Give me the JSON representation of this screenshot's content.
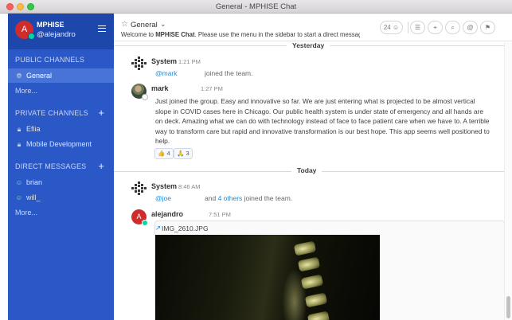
{
  "window": {
    "title": "General - MPHISE Chat"
  },
  "sidebar": {
    "team_name": "MPHISE",
    "username": "@alejandro",
    "avatar_letter": "A",
    "public_channels": {
      "title": "PUBLIC CHANNELS",
      "items": [
        {
          "label": "General",
          "icon": "globe-icon",
          "active": true
        }
      ],
      "more": "More..."
    },
    "private_channels": {
      "title": "PRIVATE CHANNELS",
      "items": [
        {
          "label": "Efiia",
          "icon": "lock-icon"
        },
        {
          "label": "Mobile Development",
          "icon": "lock-icon"
        }
      ]
    },
    "direct_messages": {
      "title": "DIRECT MESSAGES",
      "items": [
        {
          "label": "brian",
          "icon": "user-icon"
        },
        {
          "label": "will_",
          "icon": "user-icon"
        }
      ],
      "more": "More..."
    },
    "colors": {
      "background": "#2a58c6",
      "header": "#1d47ab",
      "active": "#4774d6"
    }
  },
  "header": {
    "channel_name": "General",
    "purpose": "Welcome to MPHISE Chat. Please use the menu in the sidebar to start a direct message ...",
    "purpose_bold": "MPHISE Chat",
    "member_count": "24",
    "icons": [
      "members-icon",
      "channel-files-icon",
      "pin-icon",
      "search-icon",
      "mentions-icon",
      "flag-icon"
    ]
  },
  "messages": {
    "divider_yesterday": "Yesterday",
    "divider_today": "Today",
    "posts": [
      {
        "author": "System",
        "time": "1:21 PM",
        "mention": "@mark",
        "text": "joined the team."
      },
      {
        "author": "mark",
        "time": "1:27 PM",
        "text": "Just joined the group. Easy and innovative so far. We are just entering what is projected to be almost vertical slope in COVID cases here in Chicago. Our public health system is under state of emergency and all hands are on deck. Amazing what we can do with technology instead of face to face patient care when we have to. A terrible way to transform care but rapid and innovative transformation is our best hope. This app seems well positioned to help.",
        "reactions": [
          {
            "emoji": "👍",
            "count": "4"
          },
          {
            "emoji": "🙏",
            "count": "3"
          }
        ]
      },
      {
        "author": "System",
        "time": "8:46 AM",
        "mention": "@joe",
        "text_pre": "and",
        "others_link": "4 others",
        "text": "joined the team."
      },
      {
        "author": "alejandro",
        "time": "7:51 PM",
        "avatar_letter": "A",
        "attachment_name": "IMG_2610.JPG"
      }
    ]
  }
}
